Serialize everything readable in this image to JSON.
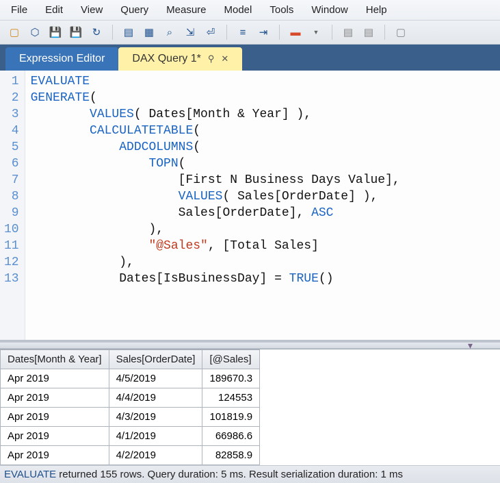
{
  "menubar": [
    "File",
    "Edit",
    "View",
    "Query",
    "Measure",
    "Model",
    "Tools",
    "Window",
    "Help"
  ],
  "tabs": {
    "inactive": "Expression Editor",
    "active": "DAX Query 1*"
  },
  "code": {
    "lines": [
      {
        "n": 1,
        "tokens": [
          {
            "t": "EVALUATE",
            "c": "kw"
          }
        ]
      },
      {
        "n": 2,
        "tokens": [
          {
            "t": "GENERATE",
            "c": "kw"
          },
          {
            "t": "(",
            "c": "id"
          }
        ]
      },
      {
        "n": 3,
        "tokens": [
          {
            "t": "        ",
            "c": "id"
          },
          {
            "t": "VALUES",
            "c": "kw"
          },
          {
            "t": "( Dates[Month & Year] ),",
            "c": "id"
          }
        ]
      },
      {
        "n": 4,
        "tokens": [
          {
            "t": "        ",
            "c": "id"
          },
          {
            "t": "CALCULATETABLE",
            "c": "kw"
          },
          {
            "t": "(",
            "c": "id"
          }
        ]
      },
      {
        "n": 5,
        "tokens": [
          {
            "t": "            ",
            "c": "id"
          },
          {
            "t": "ADDCOLUMNS",
            "c": "kw"
          },
          {
            "t": "(",
            "c": "id"
          }
        ]
      },
      {
        "n": 6,
        "tokens": [
          {
            "t": "                ",
            "c": "id"
          },
          {
            "t": "TOPN",
            "c": "kw"
          },
          {
            "t": "(",
            "c": "id"
          }
        ]
      },
      {
        "n": 7,
        "tokens": [
          {
            "t": "                    [First N Business Days Value],",
            "c": "id"
          }
        ]
      },
      {
        "n": 8,
        "tokens": [
          {
            "t": "                    ",
            "c": "id"
          },
          {
            "t": "VALUES",
            "c": "kw"
          },
          {
            "t": "( Sales[OrderDate] ),",
            "c": "id"
          }
        ]
      },
      {
        "n": 9,
        "tokens": [
          {
            "t": "                    Sales[OrderDate], ",
            "c": "id"
          },
          {
            "t": "ASC",
            "c": "kw"
          }
        ]
      },
      {
        "n": 10,
        "tokens": [
          {
            "t": "                ),",
            "c": "id"
          }
        ]
      },
      {
        "n": 11,
        "tokens": [
          {
            "t": "                ",
            "c": "id"
          },
          {
            "t": "\"@Sales\"",
            "c": "str"
          },
          {
            "t": ", [Total Sales]",
            "c": "id"
          }
        ]
      },
      {
        "n": 12,
        "tokens": [
          {
            "t": "            ),",
            "c": "id"
          }
        ]
      },
      {
        "n": 13,
        "tokens": [
          {
            "t": "            Dates[IsBusinessDay] = ",
            "c": "id"
          },
          {
            "t": "TRUE",
            "c": "kw"
          },
          {
            "t": "()",
            "c": "id"
          }
        ]
      }
    ]
  },
  "grid": {
    "columns": [
      "Dates[Month & Year]",
      "Sales[OrderDate]",
      "[@Sales]"
    ],
    "rows": [
      [
        "Apr 2019",
        "4/5/2019",
        "189670.3"
      ],
      [
        "Apr 2019",
        "4/4/2019",
        "124553"
      ],
      [
        "Apr 2019",
        "4/3/2019",
        "101819.9"
      ],
      [
        "Apr 2019",
        "4/1/2019",
        "66986.6"
      ],
      [
        "Apr 2019",
        "4/2/2019",
        "82858.9"
      ]
    ]
  },
  "status": {
    "keyword": "EVALUATE",
    "rest": " returned 155 rows. Query duration: 5 ms. Result serialization duration: 1 ms"
  }
}
